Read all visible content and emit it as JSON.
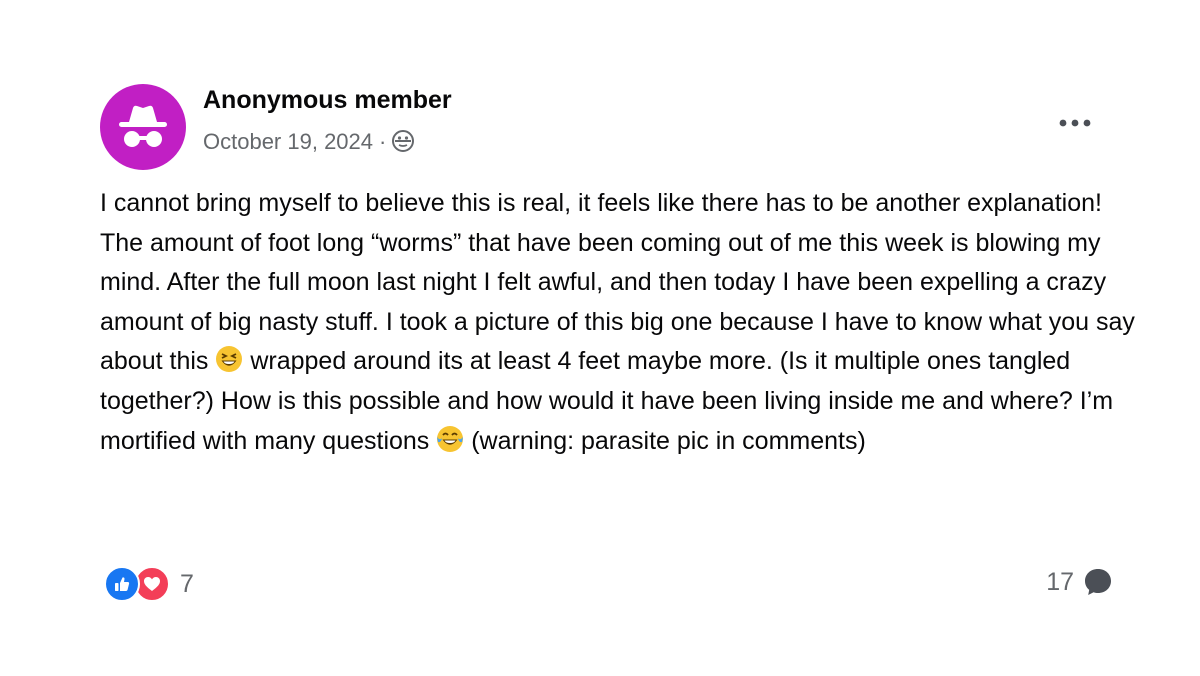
{
  "post": {
    "author": "Anonymous member",
    "date": "October 19, 2024",
    "separator": "·",
    "privacy_icon": "group-privacy-icon",
    "more_icon": "more-options-icon",
    "body": {
      "part1": "I cannot bring myself to believe this is real, it feels like there has to be another explanation! The amount of foot long “worms” that have been coming out of me this week is blowing my mind. After the full moon last night I felt awful, and then today I have been expelling a crazy amount of big nasty stuff. I took a picture of this big one because I have to know what you say about this",
      "emoji1": "grinning-squinting-face",
      "part2": "wrapped around its at least 4 feet maybe more. (Is it multiple ones tangled together?) How is this possible and how would it have been living inside me and where? I’m mortified with many questions",
      "emoji2": "face-with-tears-of-joy",
      "part3": "(warning: parasite pic in comments)"
    }
  },
  "footer": {
    "reactions": [
      "like",
      "love"
    ],
    "reaction_count": "7",
    "comment_count": "17",
    "comment_icon": "comment-bubble-icon"
  },
  "colors": {
    "avatar": "#c11fc4",
    "like": "#1877f2",
    "love": "#f33e58",
    "secondary_text": "#65686c"
  }
}
